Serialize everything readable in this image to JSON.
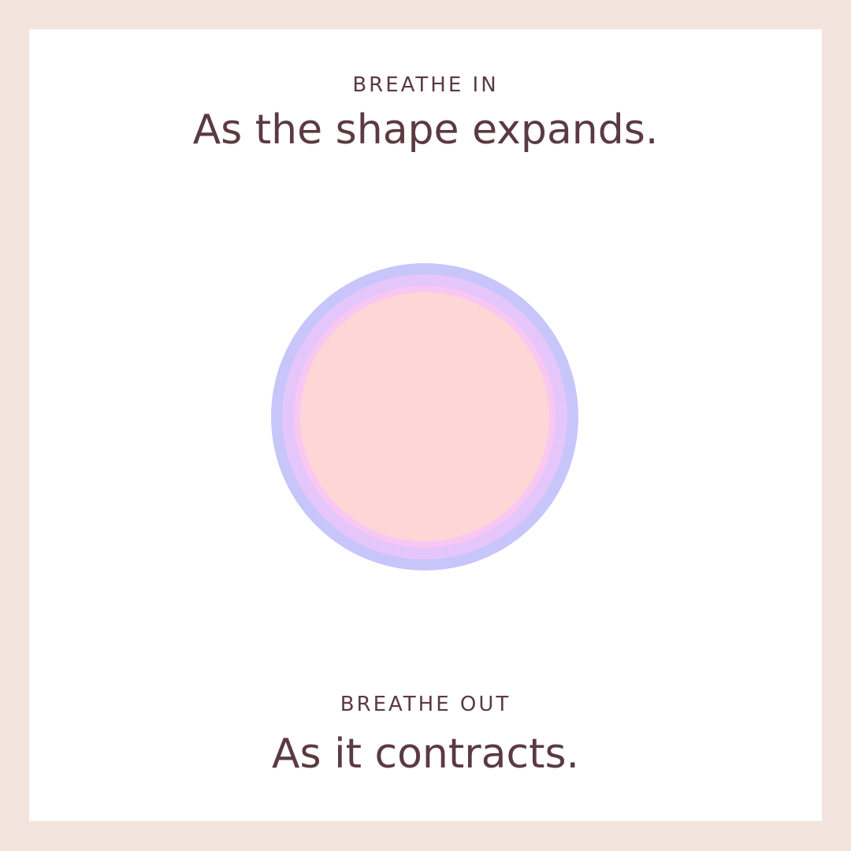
{
  "inhale": {
    "label": "BREATHE IN",
    "instruction": "As the shape expands."
  },
  "exhale": {
    "label": "BREATHE OUT",
    "instruction": "As it contracts."
  },
  "colors": {
    "border": "#f3e4dd",
    "panel": "#ffffff",
    "text": "#5b3a43",
    "ring_outer": "#c8c5fb",
    "ring_middle": "#e5c6fb",
    "ring_inner": "#f8c7f2",
    "ring_core": "#fcd7d6"
  }
}
